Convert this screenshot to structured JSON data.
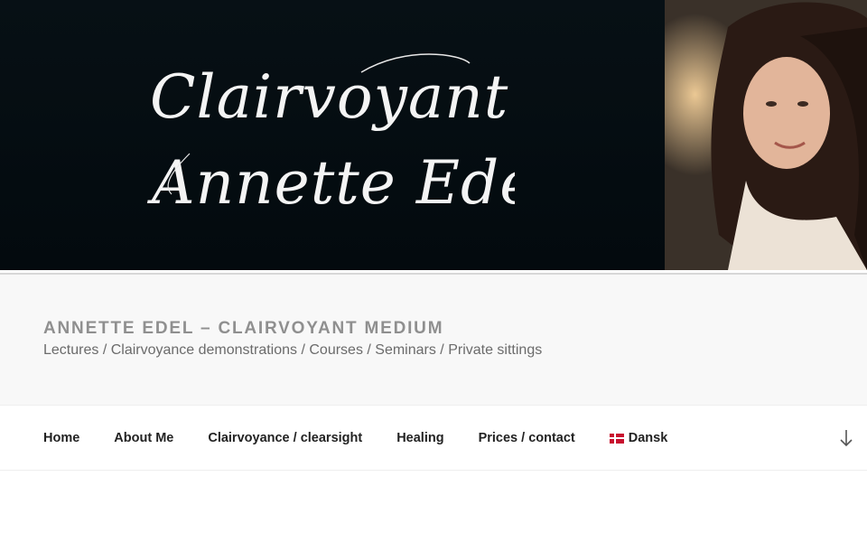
{
  "header_image": {
    "logo_line1": "Clairvoyant",
    "logo_line2": "Annette Edel"
  },
  "branding": {
    "title": "ANNETTE EDEL – CLAIRVOYANT MEDIUM",
    "description": "Lectures / Clairvoyance demonstrations / Courses / Seminars / Private sittings"
  },
  "nav": {
    "items": [
      {
        "label": "Home"
      },
      {
        "label": "About Me"
      },
      {
        "label": "Clairvoyance / clearsight"
      },
      {
        "label": "Healing"
      },
      {
        "label": "Prices / contact"
      },
      {
        "label": "Dansk",
        "icon": "danish-flag-icon"
      }
    ],
    "scroll_icon": "arrow-down-icon"
  },
  "colors": {
    "hero_bg": "#050d12",
    "branding_bg": "#f8f8f8",
    "title_color": "#8f8f8f",
    "nav_text": "#222222"
  }
}
